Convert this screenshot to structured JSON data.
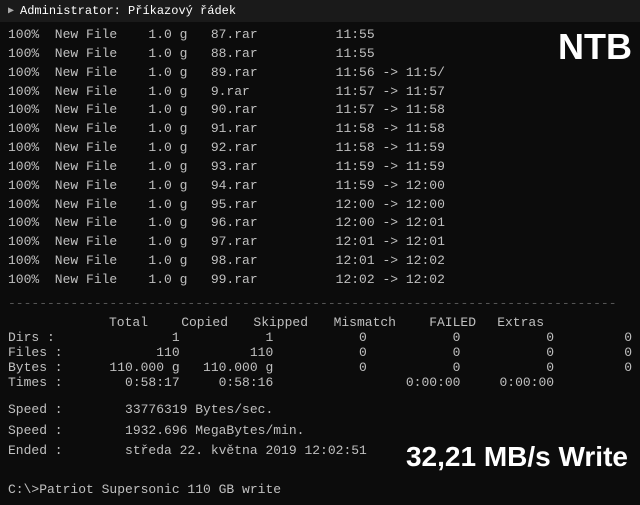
{
  "titleBar": {
    "icon": "▶",
    "title": "Administrator: Příkazový řádek"
  },
  "ntbBadge": "NTB",
  "files": [
    {
      "pct": "100%",
      "action": "New File",
      "size": "1.0",
      "unit": "g",
      "name": "87.rar",
      "time": "11:55"
    },
    {
      "pct": "100%",
      "action": "New File",
      "size": "1.0",
      "unit": "g",
      "name": "88.rar",
      "time": "11:55"
    },
    {
      "pct": "100%",
      "action": "New File",
      "size": "1.0",
      "unit": "g",
      "name": "89.rar",
      "time": "11:56 -> 11:5/"
    },
    {
      "pct": "100%",
      "action": "New File",
      "size": "1.0",
      "unit": "g",
      "name": "9.rar",
      "time": "11:57 -> 11:57"
    },
    {
      "pct": "100%",
      "action": "New File",
      "size": "1.0",
      "unit": "g",
      "name": "90.rar",
      "time": "11:57 -> 11:58"
    },
    {
      "pct": "100%",
      "action": "New File",
      "size": "1.0",
      "unit": "g",
      "name": "91.rar",
      "time": "11:58 -> 11:58"
    },
    {
      "pct": "100%",
      "action": "New File",
      "size": "1.0",
      "unit": "g",
      "name": "92.rar",
      "time": "11:58 -> 11:59"
    },
    {
      "pct": "100%",
      "action": "New File",
      "size": "1.0",
      "unit": "g",
      "name": "93.rar",
      "time": "11:59 -> 11:59"
    },
    {
      "pct": "100%",
      "action": "New File",
      "size": "1.0",
      "unit": "g",
      "name": "94.rar",
      "time": "11:59 -> 12:00"
    },
    {
      "pct": "100%",
      "action": "New File",
      "size": "1.0",
      "unit": "g",
      "name": "95.rar",
      "time": "12:00 -> 12:00"
    },
    {
      "pct": "100%",
      "action": "New File",
      "size": "1.0",
      "unit": "g",
      "name": "96.rar",
      "time": "12:00 -> 12:01"
    },
    {
      "pct": "100%",
      "action": "New File",
      "size": "1.0",
      "unit": "g",
      "name": "97.rar",
      "time": "12:01 -> 12:01"
    },
    {
      "pct": "100%",
      "action": "New File",
      "size": "1.0",
      "unit": "g",
      "name": "98.rar",
      "time": "12:01 -> 12:02"
    },
    {
      "pct": "100%",
      "action": "New File",
      "size": "1.0",
      "unit": "g",
      "name": "99.rar",
      "time": "12:02 -> 12:02"
    }
  ],
  "divider": "------------------------------------------------------------------------------",
  "statsHeaders": {
    "total": "Total",
    "copied": "Copied",
    "skipped": "Skipped",
    "mismatch": "Mismatch",
    "failed": "FAILED",
    "extras": "Extras"
  },
  "statsRows": [
    {
      "label": "Dirs :",
      "total": "1",
      "copied": "1",
      "skipped": "0",
      "mismatch": "0",
      "failed": "0",
      "extras": "0"
    },
    {
      "label": "Files :",
      "total": "110",
      "copied": "110",
      "skipped": "0",
      "mismatch": "0",
      "failed": "0",
      "extras": "0"
    },
    {
      "label": "Bytes :",
      "total": "110.000 g",
      "copied": "110.000 g",
      "skipped": "0",
      "mismatch": "0",
      "failed": "0",
      "extras": "0"
    },
    {
      "label": "Times :",
      "total": "0:58:17",
      "copied": "0:58:16",
      "skipped": "",
      "mismatch": "0:00:00",
      "failed": "0:00:00",
      "extras": ""
    }
  ],
  "speedLines": [
    {
      "label": "Speed :",
      "value": "33776319 Bytes/sec."
    },
    {
      "label": "Speed :",
      "value": "1932.696 MegaBytes/min."
    },
    {
      "label": "Ended :",
      "value": "středa 22. května 2019 12:02:51"
    }
  ],
  "writeBadge": "32,21 MB/s Write",
  "bottomPrompt": "C:\\>Patriot Supersonic 110 GB write"
}
